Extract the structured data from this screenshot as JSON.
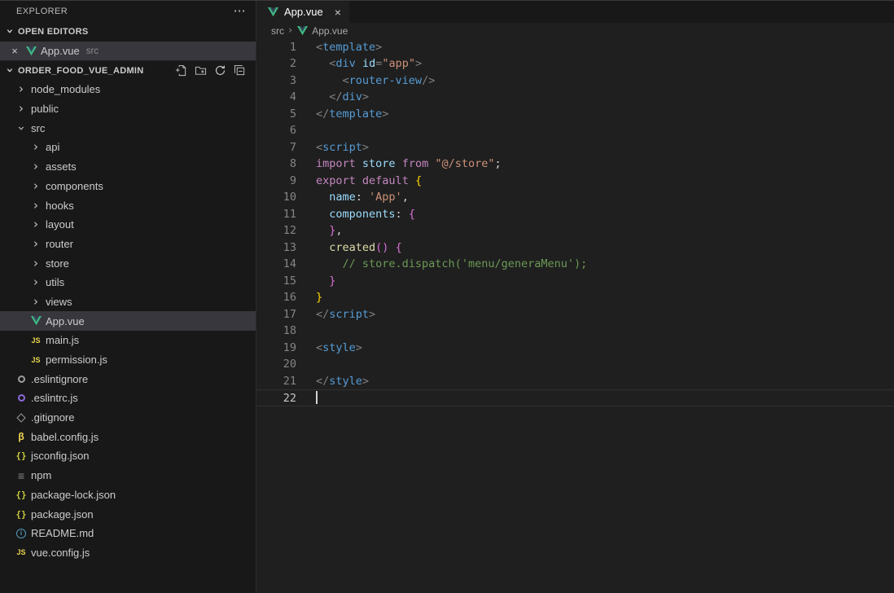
{
  "sidebar": {
    "title": "EXPLORER",
    "title_menu": "⋯",
    "open_editors": {
      "header": "OPEN EDITORS",
      "items": [
        {
          "icon": "vue",
          "label": "App.vue",
          "detail": "src",
          "close": "×",
          "active": true
        }
      ]
    },
    "project": {
      "header": "ORDER_FOOD_VUE_ADMIN",
      "actions": [
        {
          "name": "new-file"
        },
        {
          "name": "new-folder"
        },
        {
          "name": "refresh"
        },
        {
          "name": "collapse-all"
        }
      ]
    },
    "tree": [
      {
        "label": "node_modules",
        "icon": "chevron",
        "indent": 0
      },
      {
        "label": "public",
        "icon": "chevron",
        "indent": 0
      },
      {
        "label": "src",
        "icon": "chevron-down",
        "indent": 0,
        "expanded": true
      },
      {
        "label": "api",
        "icon": "chevron",
        "indent": 1
      },
      {
        "label": "assets",
        "icon": "chevron",
        "indent": 1
      },
      {
        "label": "components",
        "icon": "chevron",
        "indent": 1
      },
      {
        "label": "hooks",
        "icon": "chevron",
        "indent": 1
      },
      {
        "label": "layout",
        "icon": "chevron",
        "indent": 1
      },
      {
        "label": "router",
        "icon": "chevron",
        "indent": 1
      },
      {
        "label": "store",
        "icon": "chevron",
        "indent": 1
      },
      {
        "label": "utils",
        "icon": "chevron",
        "indent": 1
      },
      {
        "label": "views",
        "icon": "chevron",
        "indent": 1
      },
      {
        "label": "App.vue",
        "icon": "vue",
        "indent": 1,
        "selected": true
      },
      {
        "label": "main.js",
        "icon": "js",
        "indent": 1
      },
      {
        "label": "permission.js",
        "icon": "js",
        "indent": 1
      },
      {
        "label": ".eslintignore",
        "icon": "eslint-gray",
        "indent": 0
      },
      {
        "label": ".eslintrc.js",
        "icon": "eslint",
        "indent": 0
      },
      {
        "label": ".gitignore",
        "icon": "git",
        "indent": 0
      },
      {
        "label": "babel.config.js",
        "icon": "babel",
        "indent": 0
      },
      {
        "label": "jsconfig.json",
        "icon": "json",
        "indent": 0
      },
      {
        "label": "npm",
        "icon": "npm",
        "indent": 0
      },
      {
        "label": "package-lock.json",
        "icon": "json",
        "indent": 0
      },
      {
        "label": "package.json",
        "icon": "json",
        "indent": 0
      },
      {
        "label": "README.md",
        "icon": "info",
        "indent": 0
      },
      {
        "label": "vue.config.js",
        "icon": "js",
        "indent": 0
      }
    ]
  },
  "editor": {
    "tab": {
      "icon": "vue",
      "label": "App.vue",
      "close": "×",
      "active": true
    },
    "breadcrumb": {
      "root": "src",
      "separator": "›",
      "file": "App.vue"
    },
    "code": {
      "cursor_line": 22,
      "lines": [
        {
          "n": 1,
          "tokens": [
            [
              "p",
              "<"
            ],
            [
              "tag",
              "template"
            ],
            [
              "p",
              ">"
            ]
          ]
        },
        {
          "n": 2,
          "tokens": [
            [
              "d",
              "  "
            ],
            [
              "p",
              "<"
            ],
            [
              "tag",
              "div"
            ],
            [
              "d",
              " "
            ],
            [
              "attr",
              "id"
            ],
            [
              "p",
              "="
            ],
            [
              "str",
              "\"app\""
            ],
            [
              "p",
              ">"
            ]
          ]
        },
        {
          "n": 3,
          "tokens": [
            [
              "d",
              "    "
            ],
            [
              "p",
              "<"
            ],
            [
              "tag",
              "router-view"
            ],
            [
              "p",
              "/>"
            ]
          ]
        },
        {
          "n": 4,
          "tokens": [
            [
              "d",
              "  "
            ],
            [
              "p",
              "</"
            ],
            [
              "tag",
              "div"
            ],
            [
              "p",
              ">"
            ]
          ]
        },
        {
          "n": 5,
          "tokens": [
            [
              "p",
              "</"
            ],
            [
              "tag",
              "template"
            ],
            [
              "p",
              ">"
            ]
          ]
        },
        {
          "n": 6,
          "tokens": []
        },
        {
          "n": 7,
          "tokens": [
            [
              "p",
              "<"
            ],
            [
              "tag",
              "script"
            ],
            [
              "p",
              ">"
            ]
          ]
        },
        {
          "n": 8,
          "tokens": [
            [
              "kw",
              "import"
            ],
            [
              "d",
              " "
            ],
            [
              "var",
              "store"
            ],
            [
              "d",
              " "
            ],
            [
              "kw",
              "from"
            ],
            [
              "d",
              " "
            ],
            [
              "str",
              "\"@/store\""
            ],
            [
              "d",
              ";"
            ]
          ]
        },
        {
          "n": 9,
          "tokens": [
            [
              "kw",
              "export"
            ],
            [
              "d",
              " "
            ],
            [
              "kw",
              "default"
            ],
            [
              "d",
              " "
            ],
            [
              "b1",
              "{"
            ]
          ]
        },
        {
          "n": 10,
          "tokens": [
            [
              "d",
              "  "
            ],
            [
              "var",
              "name"
            ],
            [
              "d",
              ": "
            ],
            [
              "str",
              "'App'"
            ],
            [
              "d",
              ","
            ]
          ]
        },
        {
          "n": 11,
          "tokens": [
            [
              "d",
              "  "
            ],
            [
              "var",
              "components"
            ],
            [
              "d",
              ": "
            ],
            [
              "b2",
              "{"
            ]
          ]
        },
        {
          "n": 12,
          "tokens": [
            [
              "d",
              "  "
            ],
            [
              "b2",
              "}"
            ],
            [
              "d",
              ","
            ]
          ]
        },
        {
          "n": 13,
          "tokens": [
            [
              "d",
              "  "
            ],
            [
              "fn",
              "created"
            ],
            [
              "b2",
              "()"
            ],
            [
              "d",
              " "
            ],
            [
              "b2",
              "{"
            ]
          ]
        },
        {
          "n": 14,
          "tokens": [
            [
              "d",
              "    "
            ],
            [
              "cm",
              "// store.dispatch('menu/generaMenu');"
            ]
          ]
        },
        {
          "n": 15,
          "tokens": [
            [
              "d",
              "  "
            ],
            [
              "b2",
              "}"
            ]
          ]
        },
        {
          "n": 16,
          "tokens": [
            [
              "b1",
              "}"
            ]
          ]
        },
        {
          "n": 17,
          "tokens": [
            [
              "p",
              "</"
            ],
            [
              "tag",
              "script"
            ],
            [
              "p",
              ">"
            ]
          ]
        },
        {
          "n": 18,
          "tokens": []
        },
        {
          "n": 19,
          "tokens": [
            [
              "p",
              "<"
            ],
            [
              "tag",
              "style"
            ],
            [
              "p",
              ">"
            ]
          ]
        },
        {
          "n": 20,
          "tokens": []
        },
        {
          "n": 21,
          "tokens": [
            [
              "p",
              "</"
            ],
            [
              "tag",
              "style"
            ],
            [
              "p",
              ">"
            ]
          ]
        },
        {
          "n": 22,
          "tokens": [],
          "active": true,
          "cursor": true
        }
      ]
    }
  },
  "colors": {
    "vue_green": "#41b883",
    "selection_bg": "#37373d",
    "sidebar_bg": "#181818",
    "editor_bg": "#1f1f1f",
    "accent_tag": "#569cd6",
    "accent_keyword": "#c586c0",
    "accent_string": "#ce9178",
    "accent_comment": "#6a9955"
  }
}
